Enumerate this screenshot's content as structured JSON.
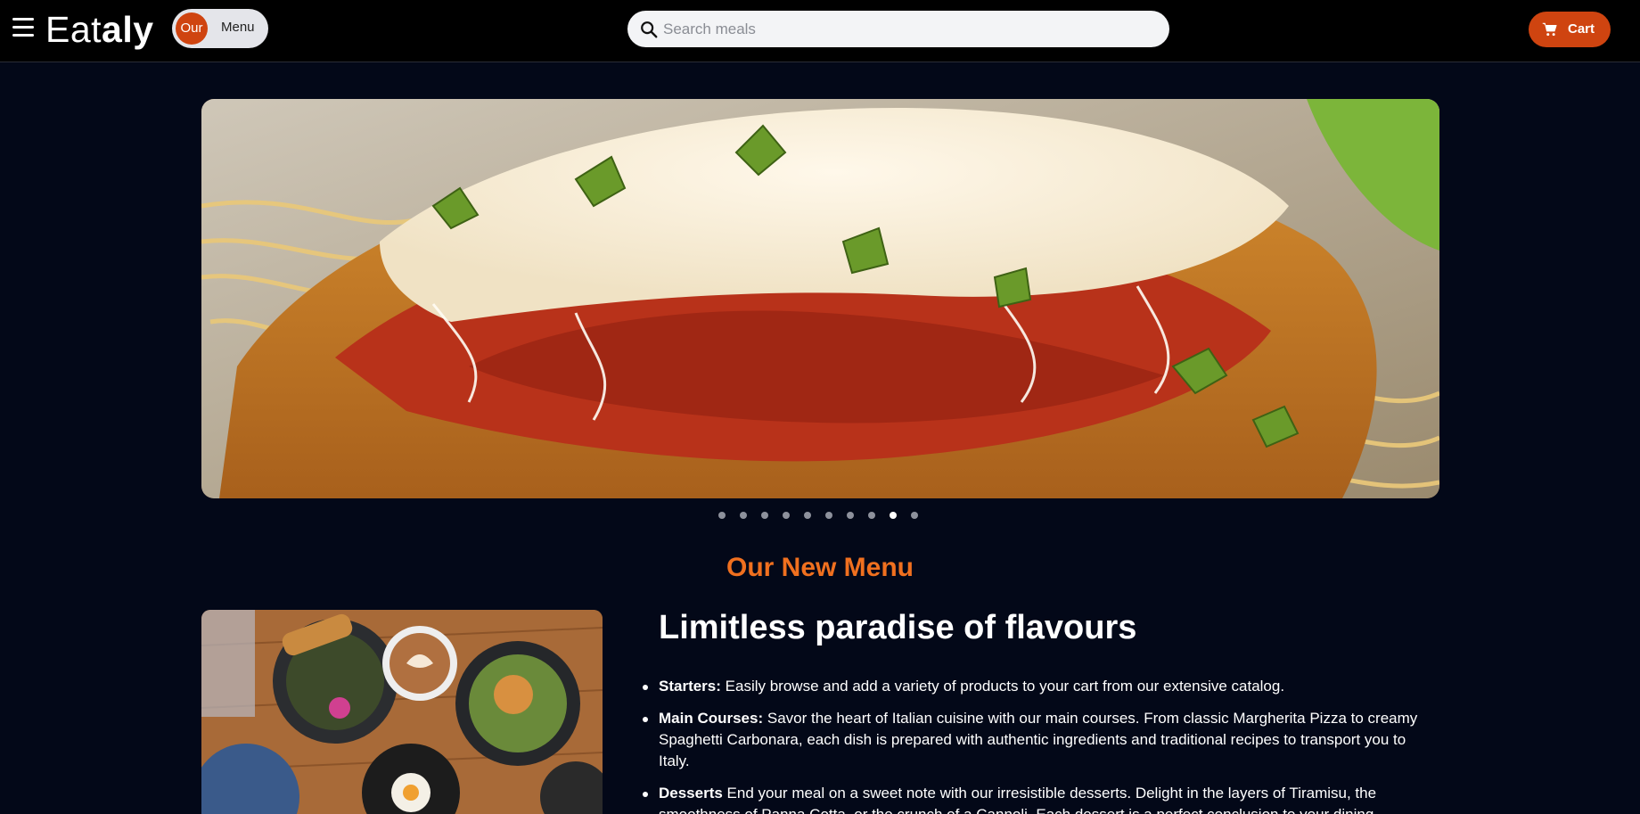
{
  "header": {
    "logo_light": "Eat",
    "logo_bold": "aly",
    "menu_toggle": {
      "active_label": "Our",
      "inactive_label": "Menu"
    },
    "search": {
      "placeholder": "Search meals",
      "value": ""
    },
    "cart_label": "Cart",
    "icons": {
      "menu": "hamburger-icon",
      "search": "search-icon",
      "cart": "cart-icon"
    }
  },
  "carousel": {
    "slide_count": 10,
    "active_index": 8,
    "slide_description_icon": "chicken-parmesan-photo"
  },
  "menu_section": {
    "title": "Our New Menu",
    "headline": "Limitless paradise of flavours",
    "features": [
      {
        "term": "Starters:",
        "text": " Easily browse and add a variety of products to your cart from our extensive catalog."
      },
      {
        "term": "Main Courses:",
        "text": " Savor the heart of Italian cuisine with our main courses. From classic Margherita Pizza to creamy Spaghetti Carbonara, each dish is prepared with authentic ingredients and traditional recipes to transport you to Italy."
      },
      {
        "term": "Desserts",
        "text": " End your meal on a sweet note with our irresistible desserts. Delight in the layers of Tiramisu, the smoothness of Panna Cotta, or the crunch of a Cannoli. Each dessert is a perfect conclusion to your dining"
      }
    ]
  },
  "colors": {
    "accent": "#cf4410",
    "title_orange": "#f0701f",
    "background": "#030818",
    "navbar": "#000000"
  }
}
